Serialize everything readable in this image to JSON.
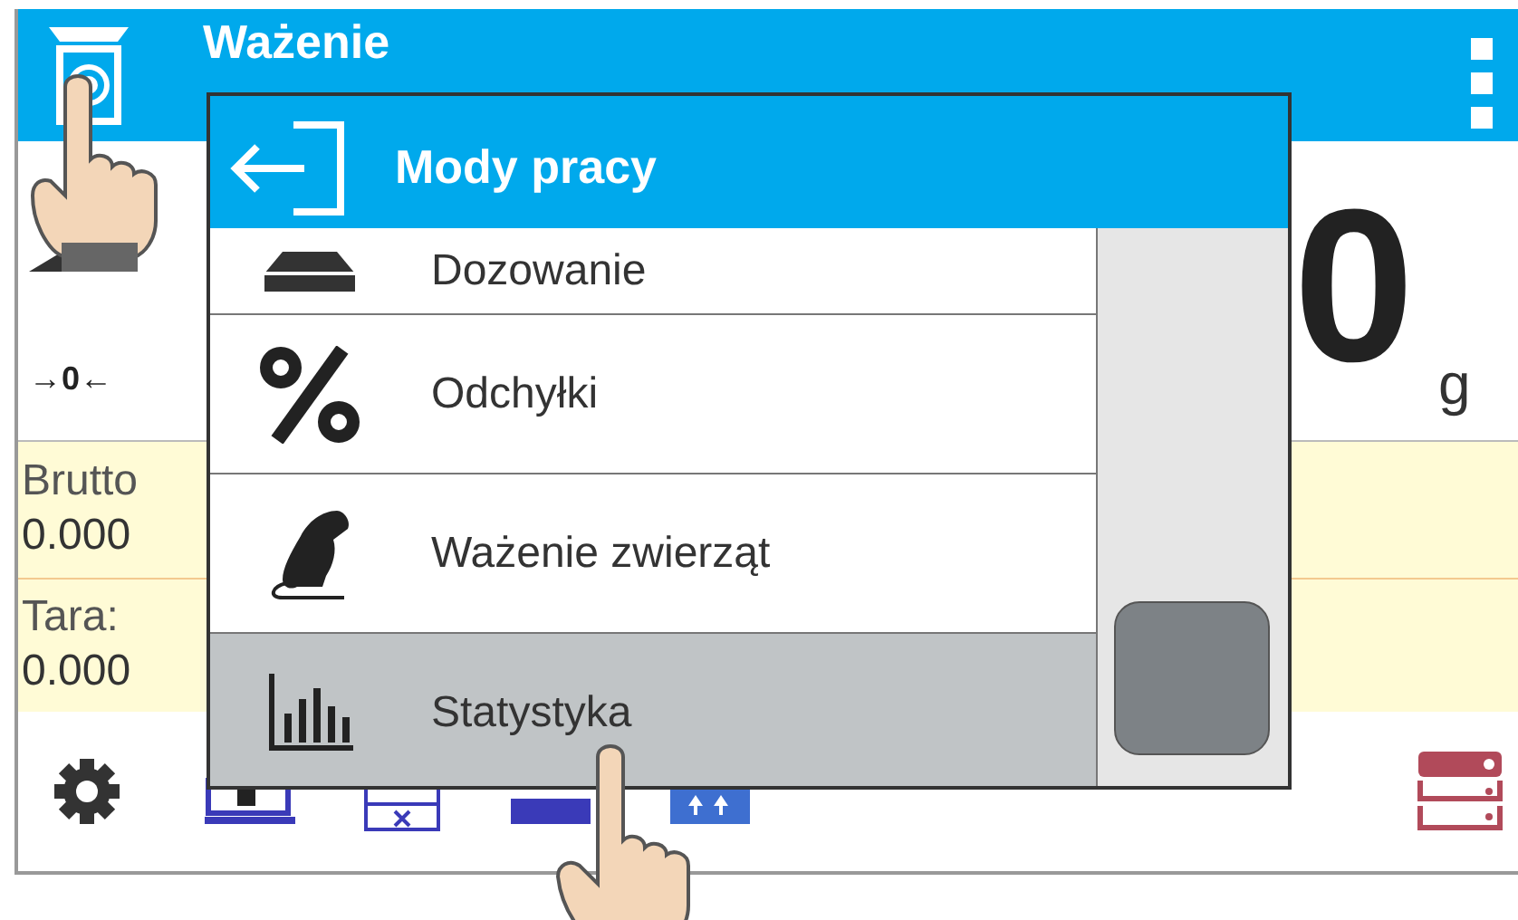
{
  "header": {
    "title": "Ważenie"
  },
  "weight": {
    "zero_indicator": "→0←",
    "value": "0",
    "unit": "g"
  },
  "info": [
    {
      "label": "Brutto",
      "value": "0.000"
    },
    {
      "label": "Tara:",
      "value": "0.000"
    }
  ],
  "menu": {
    "title": "Mody pracy",
    "items": [
      {
        "kind": "dosing",
        "label": "Dozowanie",
        "selected": false
      },
      {
        "kind": "deviation",
        "label": "Odchyłki",
        "selected": false
      },
      {
        "kind": "animal",
        "label": "Ważenie zwierząt",
        "selected": false
      },
      {
        "kind": "statistics",
        "label": "Statystyka",
        "selected": true
      }
    ]
  }
}
